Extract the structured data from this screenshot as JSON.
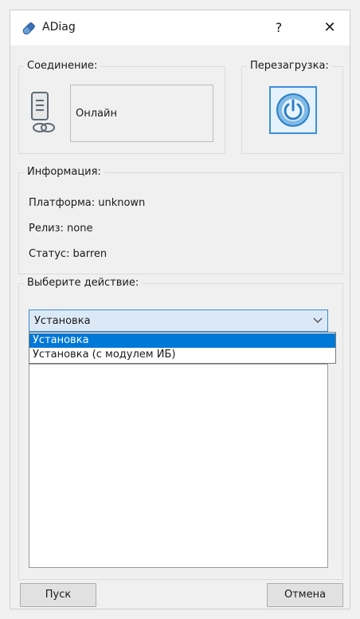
{
  "window": {
    "title": "ADiag",
    "help_label": "?",
    "close_label": "✕"
  },
  "connection": {
    "legend": "Соединение:",
    "status": "Онлайн"
  },
  "reboot": {
    "legend": "Перезагрузка:"
  },
  "info": {
    "legend": "Информация:",
    "platform": "Платформа: unknown",
    "release": "Релиз: none",
    "status": "Статус: barren"
  },
  "action": {
    "legend": "Выберите действие:",
    "selected": "Установка",
    "options": [
      "Установка",
      "Установка (с модулем ИБ)"
    ]
  },
  "buttons": {
    "start": "Пуск",
    "cancel": "Отмена"
  },
  "colors": {
    "accent": "#0078d7",
    "select_bg": "#dbe9f7"
  }
}
